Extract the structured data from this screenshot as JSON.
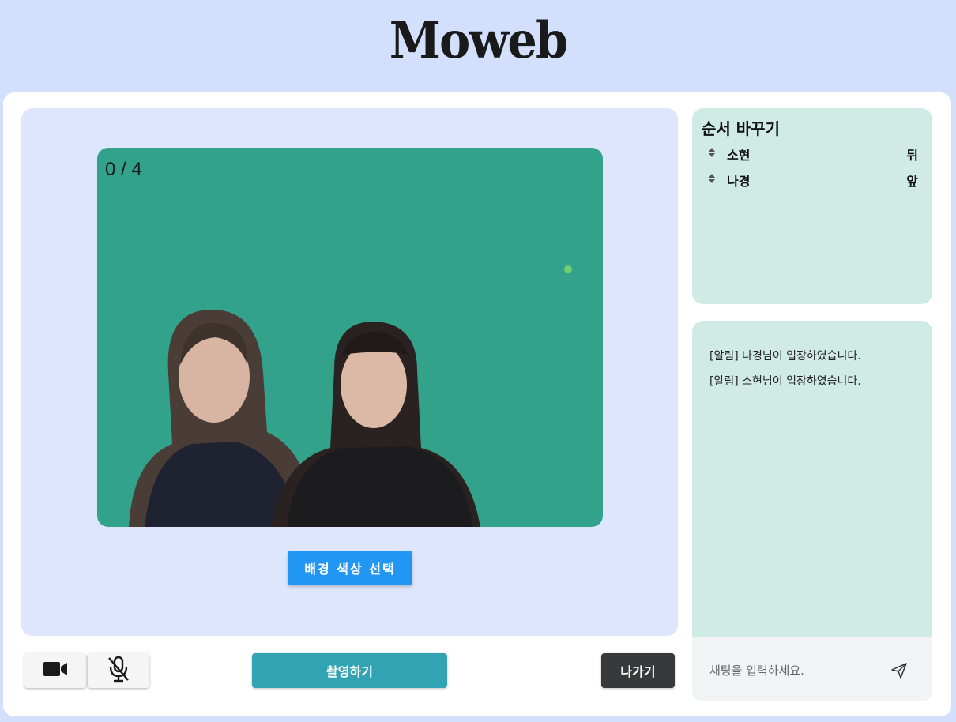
{
  "app": {
    "logo": "Moweb"
  },
  "stage": {
    "shot_counter": "0 / 4",
    "background_color": "#33a28b",
    "bg_color_button": "배경 색상 선택"
  },
  "controls": {
    "camera_icon": "video-camera-icon",
    "mic_icon": "mic-off-icon",
    "shoot_button": "촬영하기",
    "leave_button": "나가기"
  },
  "order": {
    "title": "순서 바꾸기",
    "items": [
      {
        "name": "소현",
        "position": "뒤"
      },
      {
        "name": "나경",
        "position": "앞"
      }
    ]
  },
  "chat": {
    "messages": [
      "[알림] 나경님이 입장하였습니다.",
      "[알림] 소현님이 입장하였습니다."
    ],
    "input_placeholder": "채팅을 입력하세요.",
    "send_icon": "send-icon"
  },
  "colors": {
    "page_bg": "#d2e0fd",
    "stage_bg": "#dde6fd",
    "panel_bg": "#d0ebe3",
    "primary": "#2196f3",
    "teal": "#31a3b3",
    "dark": "#37393b"
  }
}
